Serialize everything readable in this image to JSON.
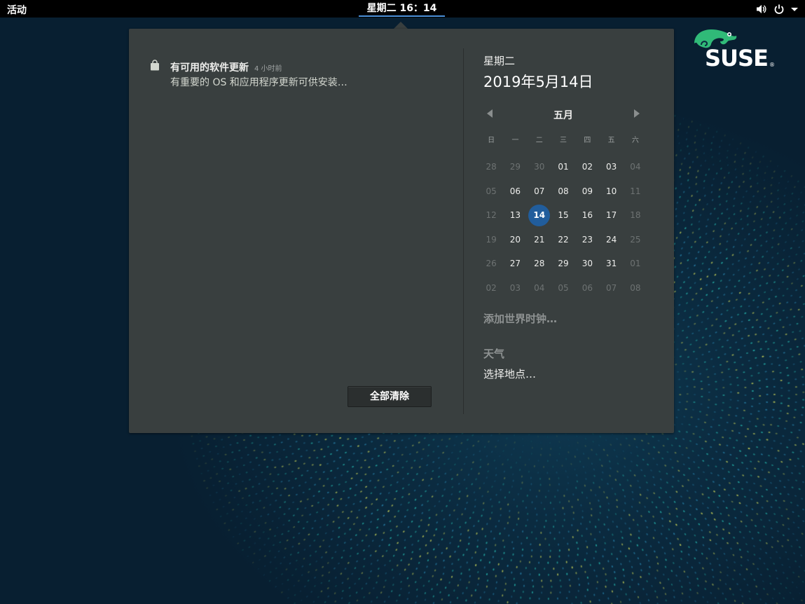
{
  "topbar": {
    "activities": "活动",
    "clock": "星期二 16：14",
    "icons": [
      "volume-icon",
      "power-icon",
      "dropdown-arrow-icon"
    ]
  },
  "logo": {
    "text": "SUSE",
    "mark": "®"
  },
  "notification": {
    "icon": "software-bag-icon",
    "title": "有可用的软件更新",
    "time": "4 小时前",
    "body": "有重要的 OS 和应用程序更新可供安装…",
    "clear_label": "全部清除"
  },
  "calendar": {
    "weekday": "星期二",
    "date": "2019年5月14日",
    "month": "五月",
    "weekday_headers": [
      "日",
      "一",
      "二",
      "三",
      "四",
      "五",
      "六"
    ],
    "days": [
      {
        "d": "28",
        "dim": true
      },
      {
        "d": "29",
        "dim": true
      },
      {
        "d": "30",
        "dim": true
      },
      {
        "d": "01"
      },
      {
        "d": "02"
      },
      {
        "d": "03"
      },
      {
        "d": "04",
        "dim": true
      },
      {
        "d": "05",
        "dim": true
      },
      {
        "d": "06"
      },
      {
        "d": "07"
      },
      {
        "d": "08"
      },
      {
        "d": "09"
      },
      {
        "d": "10"
      },
      {
        "d": "11",
        "dim": true
      },
      {
        "d": "12",
        "dim": true
      },
      {
        "d": "13"
      },
      {
        "d": "14",
        "today": true
      },
      {
        "d": "15"
      },
      {
        "d": "16"
      },
      {
        "d": "17"
      },
      {
        "d": "18",
        "dim": true
      },
      {
        "d": "19",
        "dim": true
      },
      {
        "d": "20"
      },
      {
        "d": "21"
      },
      {
        "d": "22"
      },
      {
        "d": "23"
      },
      {
        "d": "24"
      },
      {
        "d": "25",
        "dim": true
      },
      {
        "d": "26",
        "dim": true
      },
      {
        "d": "27"
      },
      {
        "d": "28"
      },
      {
        "d": "29"
      },
      {
        "d": "30"
      },
      {
        "d": "31"
      },
      {
        "d": "01",
        "dim": true
      },
      {
        "d": "02",
        "dim": true
      },
      {
        "d": "03",
        "dim": true
      },
      {
        "d": "04",
        "dim": true
      },
      {
        "d": "05",
        "dim": true
      },
      {
        "d": "06",
        "dim": true
      },
      {
        "d": "07",
        "dim": true
      },
      {
        "d": "08",
        "dim": true
      }
    ],
    "world_clocks": "添加世界时钟…",
    "weather_title": "天气",
    "weather_location": "选择地点…"
  },
  "colors": {
    "accent": "#215d9c",
    "popover": "#393f3f",
    "suse_green": "#30ba78"
  }
}
